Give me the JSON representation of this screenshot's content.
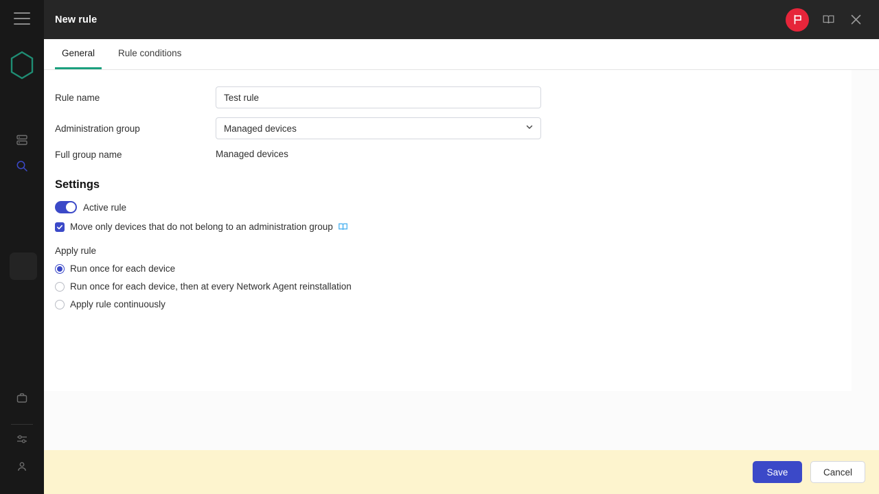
{
  "sidebar": {
    "menu_icon": "hamburger-icon",
    "logo": "hexagon-logo",
    "items": [
      {
        "icon": "server-stack-icon",
        "name": "monitoring"
      },
      {
        "icon": "search-icon",
        "name": "search"
      },
      {
        "icon": "briefcase-icon",
        "name": "briefcase"
      },
      {
        "icon": "sliders-icon",
        "name": "settings"
      },
      {
        "icon": "user-icon",
        "name": "account"
      }
    ]
  },
  "dialog": {
    "title": "New rule",
    "header_icons": [
      {
        "name": "flag-badge-icon",
        "color": "#e6253a"
      },
      {
        "name": "book-help-icon"
      },
      {
        "name": "close-icon"
      }
    ],
    "tabs": [
      {
        "label": "General",
        "active": true
      },
      {
        "label": "Rule conditions",
        "active": false
      }
    ],
    "accent_tab_color": "#1ba07e",
    "fields": {
      "rule_name": {
        "label": "Rule name",
        "value": "Test rule",
        "placeholder": ""
      },
      "administration_group": {
        "label": "Administration group",
        "value": "Managed devices"
      },
      "full_group_name": {
        "label": "Full group name",
        "value": "Managed devices"
      }
    },
    "settings": {
      "title": "Settings",
      "active_rule": {
        "label": "Active rule",
        "on": true
      },
      "move_only_devices": {
        "label": "Move only devices that do not belong to an administration group",
        "checked": true,
        "help_icon": "book-help-icon"
      },
      "apply_rule": {
        "label": "Apply rule",
        "options": [
          {
            "label": "Run once for each device",
            "selected": true
          },
          {
            "label": "Run once for each device, then at every Network Agent reinstallation",
            "selected": false
          },
          {
            "label": "Apply rule continuously",
            "selected": false
          }
        ]
      }
    },
    "footer": {
      "save_label": "Save",
      "cancel_label": "Cancel",
      "background": "#fdf4ce",
      "primary_color": "#3b49c8"
    }
  }
}
